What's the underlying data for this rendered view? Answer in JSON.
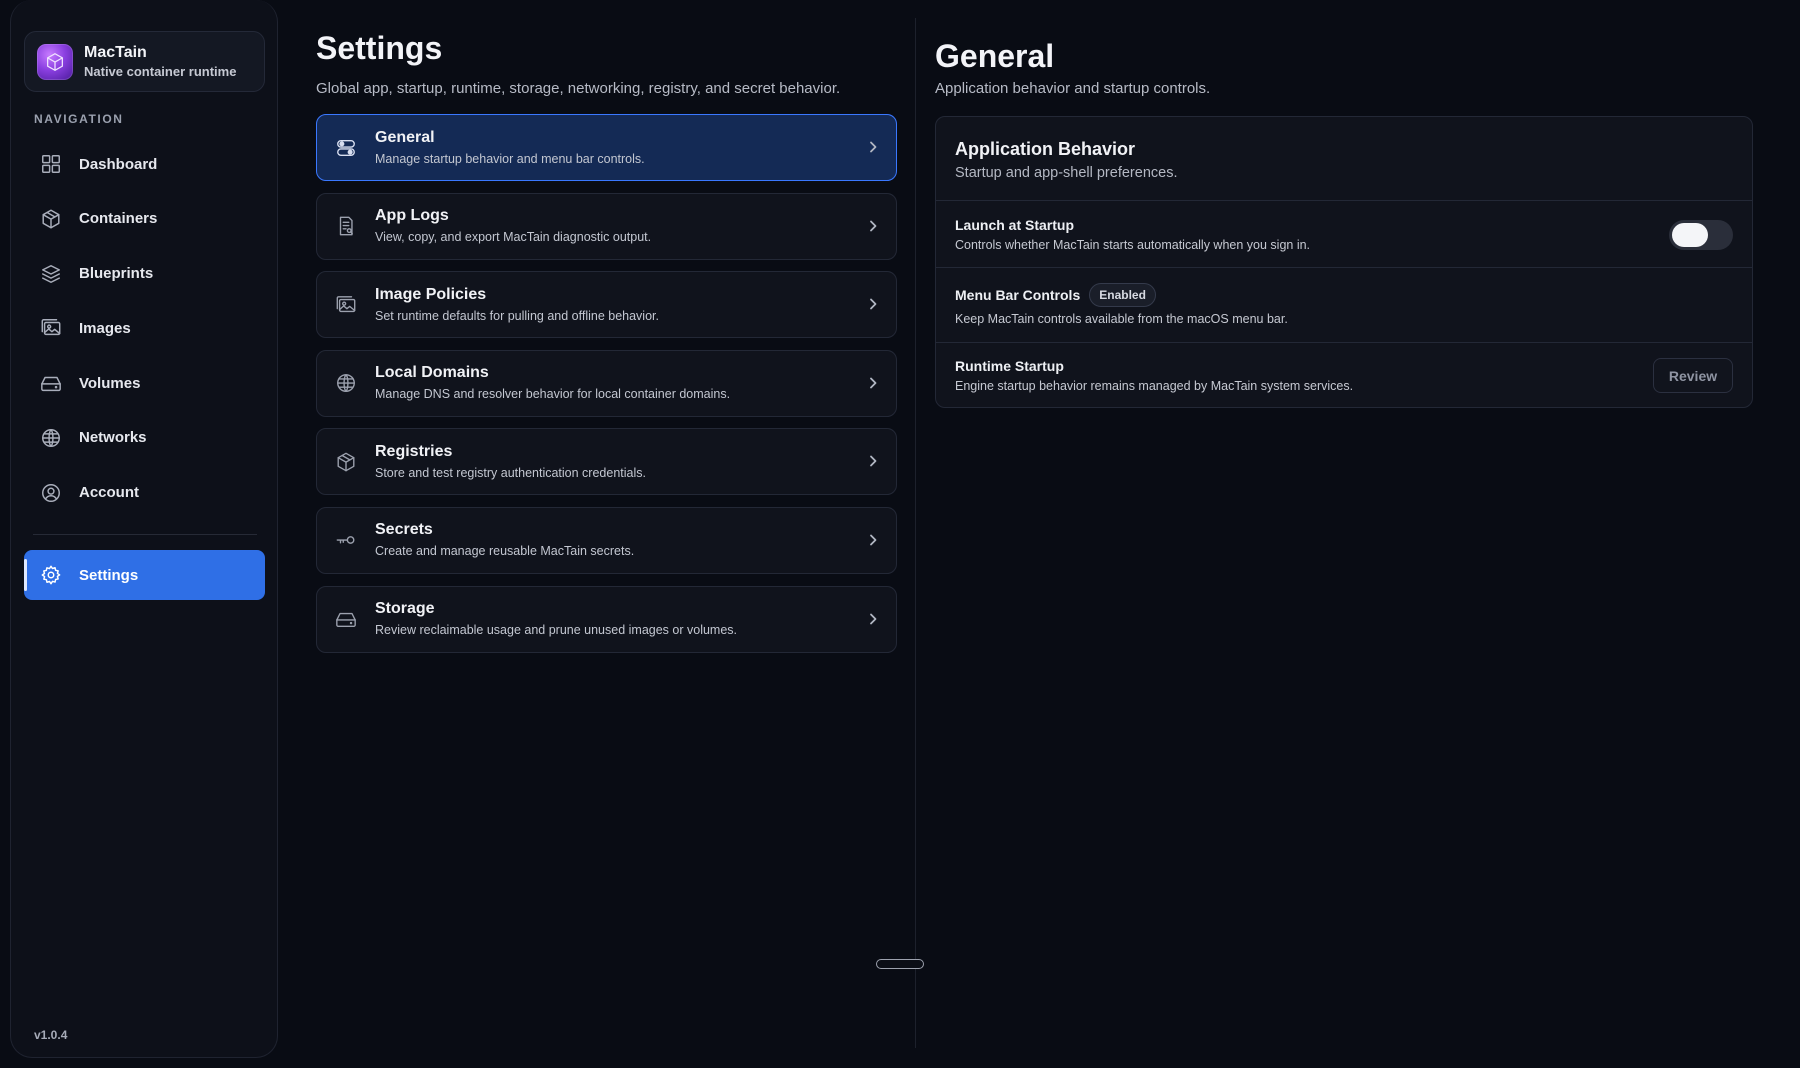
{
  "brand": {
    "name": "MacTain",
    "subtitle": "Native container runtime"
  },
  "sidebar": {
    "heading": "NAVIGATION",
    "items": [
      {
        "label": "Dashboard",
        "icon": "dashboard-icon"
      },
      {
        "label": "Containers",
        "icon": "cube-icon"
      },
      {
        "label": "Blueprints",
        "icon": "layers-icon"
      },
      {
        "label": "Images",
        "icon": "images-icon"
      },
      {
        "label": "Volumes",
        "icon": "drive-icon"
      },
      {
        "label": "Networks",
        "icon": "globe-icon"
      },
      {
        "label": "Account",
        "icon": "user-circle-icon"
      }
    ],
    "active_item": {
      "label": "Settings",
      "icon": "gear-icon"
    },
    "version": "v1.0.4"
  },
  "settings": {
    "title": "Settings",
    "subtitle": "Global app, startup, runtime, storage, networking, registry, and secret behavior.",
    "categories": [
      {
        "title": "General",
        "desc": "Manage startup behavior and menu bar controls.",
        "icon": "toggles-icon",
        "active": true
      },
      {
        "title": "App Logs",
        "desc": "View, copy, and export MacTain diagnostic output.",
        "icon": "log-file-icon"
      },
      {
        "title": "Image Policies",
        "desc": "Set runtime defaults for pulling and offline behavior.",
        "icon": "images-icon"
      },
      {
        "title": "Local Domains",
        "desc": "Manage DNS and resolver behavior for local container domains.",
        "icon": "globe-icon"
      },
      {
        "title": "Registries",
        "desc": "Store and test registry authentication credentials.",
        "icon": "cube-icon"
      },
      {
        "title": "Secrets",
        "desc": "Create and manage reusable MacTain secrets.",
        "icon": "key-icon"
      },
      {
        "title": "Storage",
        "desc": "Review reclaimable usage and prune unused images or volumes.",
        "icon": "drive-icon"
      }
    ]
  },
  "detail": {
    "title": "General",
    "subtitle": "Application behavior and startup controls.",
    "panel": {
      "title": "Application Behavior",
      "subtitle": "Startup and app-shell preferences.",
      "rows": [
        {
          "title": "Launch at Startup",
          "desc": "Controls whether MacTain starts automatically when you sign in.",
          "toggle_on": false
        },
        {
          "title": "Menu Bar Controls",
          "badge": "Enabled",
          "desc": "Keep MacTain controls available from the macOS menu bar."
        },
        {
          "title": "Runtime Startup",
          "desc": "Engine startup behavior remains managed by MacTain system services.",
          "button": "Review"
        }
      ]
    }
  },
  "colors": {
    "accent": "#2f6fe6",
    "active_card": "#142a55",
    "active_border": "#3a78ff",
    "background": "#090c14"
  }
}
